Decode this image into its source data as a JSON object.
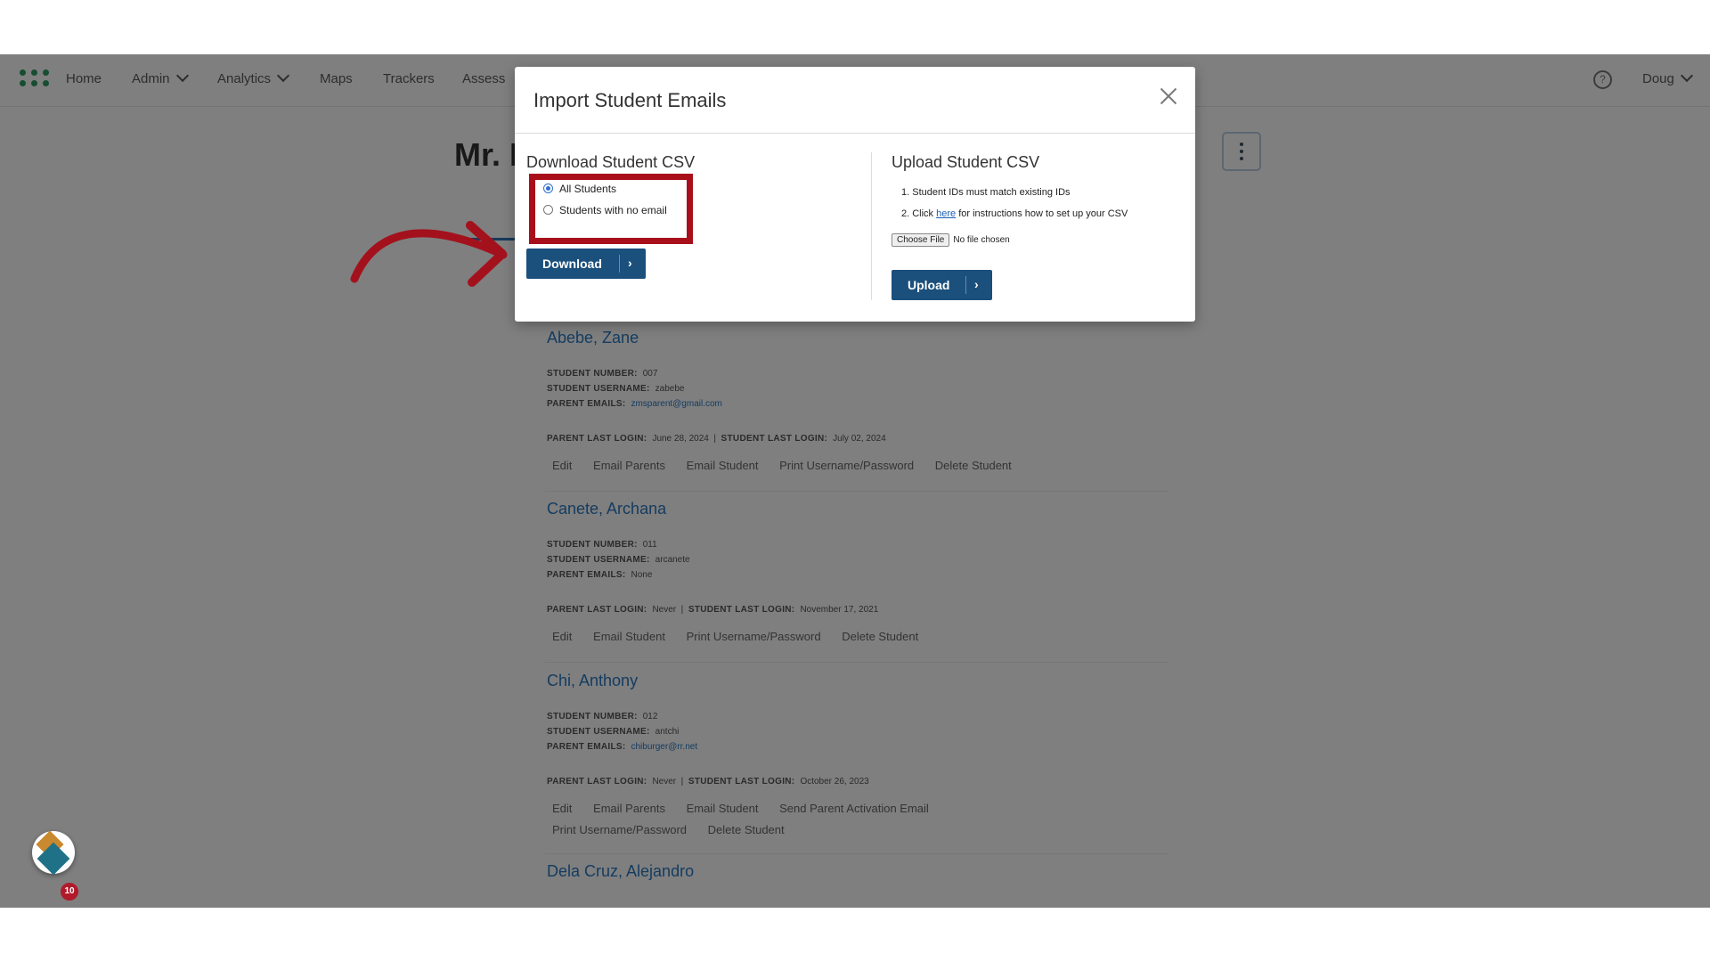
{
  "nav": {
    "home": "Home",
    "admin": "Admin",
    "analytics": "Analytics",
    "maps": "Maps",
    "trackers": "Trackers",
    "assess": "Assess",
    "user": "Doug",
    "help": "?"
  },
  "page": {
    "title": "Mr. D"
  },
  "students": [
    {
      "name": "Abebe, Zane",
      "number_label": "STUDENT NUMBER:",
      "number": "007",
      "username_label": "STUDENT USERNAME:",
      "username": "zabebe",
      "parent_emails_label": "PARENT EMAILS:",
      "parent_emails": "zmsparent@gmail.com",
      "parent_login_label": "PARENT LAST LOGIN:",
      "parent_login": "June 28, 2024",
      "student_login_label": "STUDENT LAST LOGIN:",
      "student_login": "July 02, 2024",
      "actions": [
        "Edit",
        "Email Parents",
        "Email Student",
        "Print Username/Password",
        "Delete Student"
      ]
    },
    {
      "name": "Canete, Archana",
      "number_label": "STUDENT NUMBER:",
      "number": "011",
      "username_label": "STUDENT USERNAME:",
      "username": "arcanete",
      "parent_emails_label": "PARENT EMAILS:",
      "parent_emails": "None",
      "parent_login_label": "PARENT LAST LOGIN:",
      "parent_login": "Never",
      "student_login_label": "STUDENT LAST LOGIN:",
      "student_login": "November 17, 2021",
      "actions": [
        "Edit",
        "Email Student",
        "Print Username/Password",
        "Delete Student"
      ]
    },
    {
      "name": "Chi, Anthony",
      "number_label": "STUDENT NUMBER:",
      "number": "012",
      "username_label": "STUDENT USERNAME:",
      "username": "antchi",
      "parent_emails_label": "PARENT EMAILS:",
      "parent_emails": "chiburger@rr.net",
      "parent_login_label": "PARENT LAST LOGIN:",
      "parent_login": "Never",
      "student_login_label": "STUDENT LAST LOGIN:",
      "student_login": "October 26, 2023",
      "actions": [
        "Edit",
        "Email Parents",
        "Email Student",
        "Send Parent Activation Email"
      ],
      "actions_row2": [
        "Print Username/Password",
        "Delete Student"
      ]
    },
    {
      "name": "Dela Cruz, Alejandro"
    }
  ],
  "modal": {
    "title": "Import Student Emails",
    "download": {
      "heading": "Download Student CSV",
      "options": [
        {
          "label": "All Students",
          "selected": true
        },
        {
          "label": "Students with no email",
          "selected": false
        }
      ],
      "button": "Download",
      "button_arrow": "›"
    },
    "upload": {
      "heading": "Upload Student CSV",
      "step1": "1. Student IDs must match existing IDs",
      "step2_prefix": "2. Click",
      "step2_link": "here",
      "step2_suffix": "for instructions how to set up your CSV",
      "choose_file": "Choose File",
      "no_file": "No file chosen",
      "button": "Upload",
      "button_arrow": "›"
    }
  },
  "widget": {
    "badge_count": "10"
  },
  "colors": {
    "highlight_box": "#a80f1a",
    "arrow": "#a3121c",
    "primary_button": "#1b4f7c",
    "link": "#2a78c0"
  }
}
